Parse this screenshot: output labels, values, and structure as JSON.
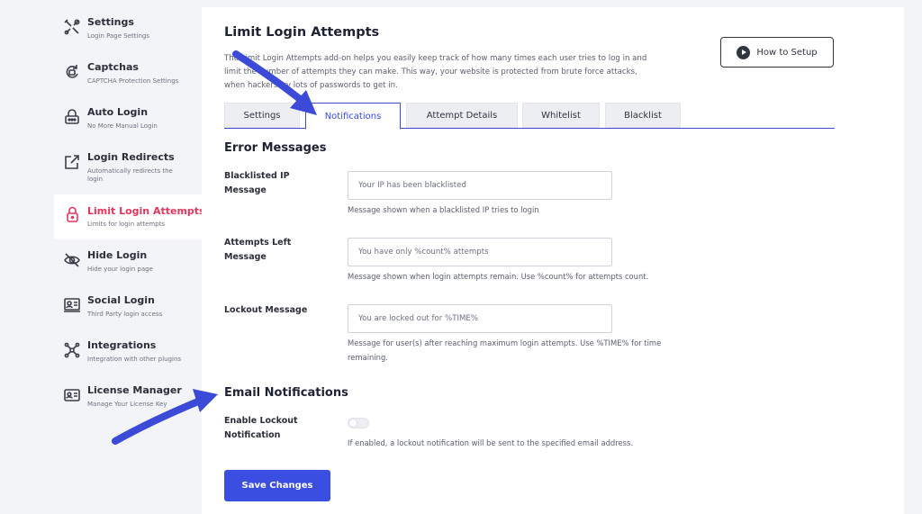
{
  "sidebar": {
    "items": [
      {
        "title": "Settings",
        "subtitle": "Login Page Settings",
        "icon": "tools-icon"
      },
      {
        "title": "Captchas",
        "subtitle": "CAPTCHA Protection Settings",
        "icon": "captcha-icon"
      },
      {
        "title": "Auto Login",
        "subtitle": "No More Manual Login",
        "icon": "auto-login-icon"
      },
      {
        "title": "Login Redirects",
        "subtitle": "Automatically redirects the login",
        "icon": "redirect-icon"
      },
      {
        "title": "Limit Login Attempts",
        "subtitle": "Limits for login attempts",
        "icon": "lock-icon"
      },
      {
        "title": "Hide Login",
        "subtitle": "Hide your login page",
        "icon": "eye-off-icon"
      },
      {
        "title": "Social Login",
        "subtitle": "Third Party login access",
        "icon": "social-login-icon"
      },
      {
        "title": "Integrations",
        "subtitle": "Integration with other plugins",
        "icon": "integrations-icon"
      },
      {
        "title": "License Manager",
        "subtitle": "Manage Your License Key",
        "icon": "license-icon"
      }
    ],
    "active_index": 4
  },
  "header": {
    "title": "Limit Login Attempts",
    "intro": "The Limit Login Attempts add-on helps you easily keep track of how many times each user tries to log in and limit the number of attempts they can make. This way, your website is protected from brute force attacks, when hackers try lots of passwords to get in.",
    "how_to_label": "How to Setup"
  },
  "tabs": [
    {
      "label": "Settings"
    },
    {
      "label": "Notifications"
    },
    {
      "label": "Attempt Details"
    },
    {
      "label": "Whitelist"
    },
    {
      "label": "Blacklist"
    }
  ],
  "active_tab": "Notifications",
  "error_section": {
    "title": "Error Messages",
    "fields": [
      {
        "label": "Blacklisted IP Message",
        "placeholder": "Your IP has been blacklisted",
        "help": "Message shown when a blacklisted IP tries to login"
      },
      {
        "label": "Attempts Left Message",
        "placeholder": "You have only %count% attempts",
        "help": "Message shown when login attempts remain. Use %count% for attempts count."
      },
      {
        "label": "Lockout Message",
        "placeholder": "You are locked out for %TIME%",
        "help": "Message for user(s) after reaching maximum login attempts. Use %TIME% for time remaining."
      }
    ]
  },
  "email_section": {
    "title": "Email Notifications",
    "toggle_label": "Enable Lockout Notification",
    "toggle_help": "If enabled, a lockout notification will be sent to the specified email address.",
    "toggle_on": false
  },
  "save_label": "Save Changes",
  "colors": {
    "accent": "#3a4ee2",
    "active_sidebar": "#e5365b",
    "annotation_arrow": "#3b4bd8"
  }
}
